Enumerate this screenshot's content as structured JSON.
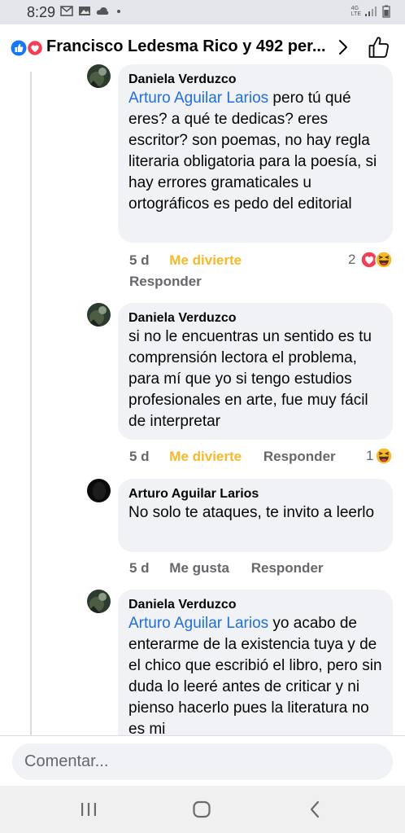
{
  "status_bar": {
    "time": "8:29",
    "network": "4G",
    "lte": "LTE"
  },
  "header": {
    "title": "Francisco Ledesma Rico y 492 per..."
  },
  "comments": [
    {
      "author": "Daniela Verduzco",
      "mention": "Arturo Aguilar Larios",
      "text": " pero tú qué eres? a qué te dedicas? eres escritor? son poemas, no hay regla literaria obligatoria para la poesía, si hay errores gramaticales u ortográficos es pedo del editorial",
      "time": "5 d",
      "reaction_label": "Me divierte",
      "reply_label": "Responder",
      "reaction_count": "2"
    },
    {
      "author": "Daniela Verduzco",
      "text": "si no le encuentras un sentido es tu comprensión lectora el problema, para mí que yo si tengo estudios profesionales en arte, fue muy fácil de interpretar",
      "time": "5 d",
      "reaction_label": "Me divierte",
      "reply_label": "Responder",
      "reaction_count": "1"
    },
    {
      "author": "Arturo Aguilar Larios",
      "text": "No solo te ataques, te invito a leerlo",
      "time": "5 d",
      "reaction_label": "Me gusta",
      "reply_label": "Responder"
    },
    {
      "author": "Daniela Verduzco",
      "mention": "Arturo Aguilar Larios",
      "text": " yo acabo de enterarme de la existencia tuya y de el chico que escribió el libro, pero sin duda lo leeré antes de criticar y ni pienso hacerlo pues la literatura no es mi"
    }
  ],
  "composer": {
    "placeholder": "Comentar..."
  },
  "colors": {
    "mention": "#216fdb",
    "haha_reaction": "#f7b928",
    "meta_text": "#65676b",
    "bubble_bg": "#f0f2f5"
  },
  "icons": [
    "like-reaction-icon",
    "love-reaction-icon",
    "haha-reaction-icon",
    "chevron-right-icon",
    "thumbs-up-icon",
    "recent-apps-icon",
    "home-icon",
    "back-icon"
  ]
}
